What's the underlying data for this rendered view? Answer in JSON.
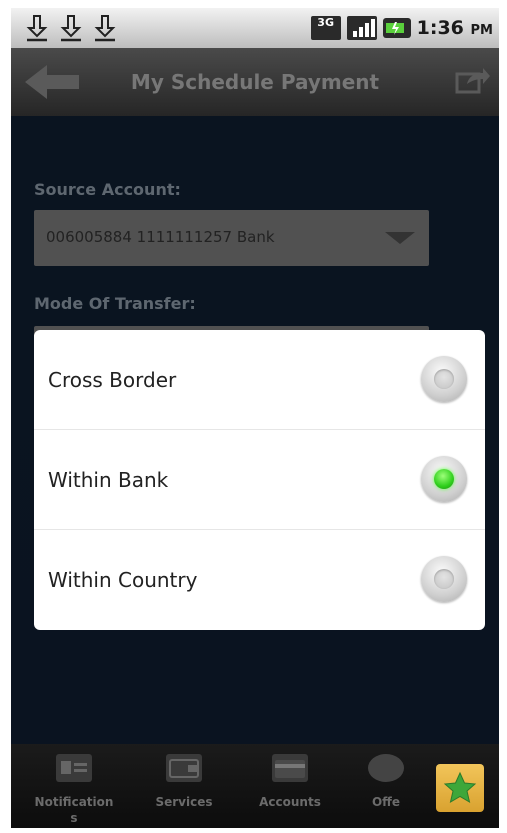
{
  "status_bar": {
    "icons": [
      "download-icon",
      "download-icon",
      "download-icon"
    ],
    "network": "3G",
    "time": "1:36",
    "time_suffix": "PM"
  },
  "title_bar": {
    "title": "My Schedule Payment"
  },
  "form": {
    "source_account_label": "Source Account:",
    "source_account_value": "006005884 1111111257 Bank",
    "mode_label": "Mode Of Transfer:"
  },
  "dialog": {
    "options": [
      {
        "label": "Cross Border",
        "selected": false
      },
      {
        "label": "Within Bank",
        "selected": true
      },
      {
        "label": "Within Country",
        "selected": false
      }
    ]
  },
  "bottom_nav": {
    "items": [
      {
        "label": "Notification s",
        "icon": "contact-card-icon"
      },
      {
        "label": "Services",
        "icon": "wallet-icon"
      },
      {
        "label": "Accounts",
        "icon": "card-icon"
      },
      {
        "label": "Offe",
        "icon": "badge-icon"
      }
    ],
    "star_icon": "star-icon"
  },
  "colors": {
    "accent_selected": "#2fcf1c",
    "content_bg": "#0a1420",
    "star_button": "#e2b040"
  }
}
